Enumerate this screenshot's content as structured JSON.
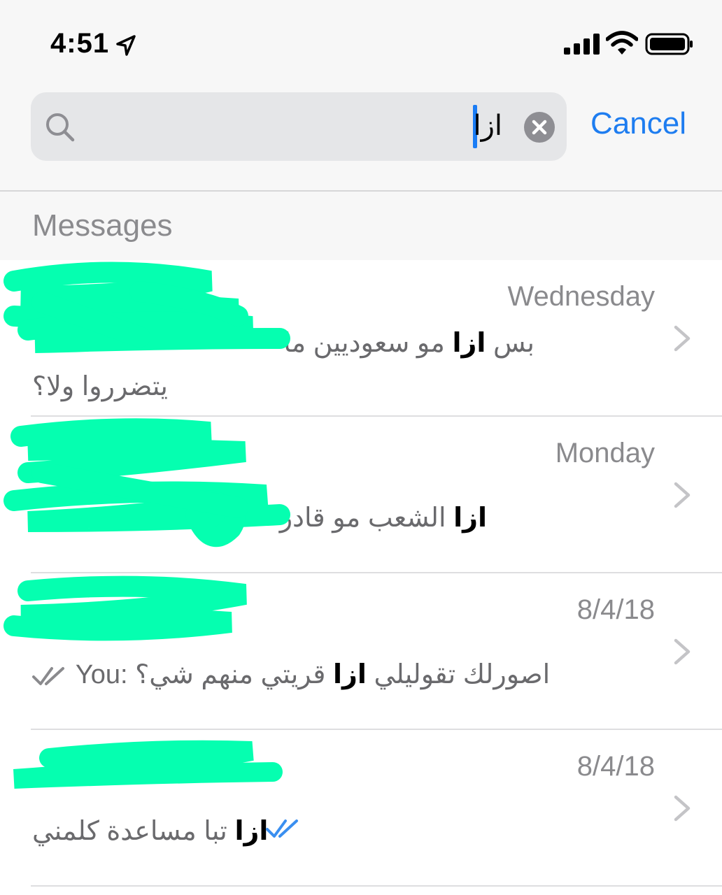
{
  "status_bar": {
    "time": "4:51",
    "icons": [
      "location-arrow-icon",
      "cellular-signal-icon",
      "wifi-icon",
      "battery-icon"
    ]
  },
  "search": {
    "query": "ازا",
    "cancel_label": "Cancel"
  },
  "section_title": "Messages",
  "colors": {
    "accent": "#1e7df0",
    "redaction": "#05ffb0",
    "read_tick_blue": "#3a8ff0",
    "read_tick_gray": "#8a8a8d"
  },
  "results": [
    {
      "date": "Wednesday",
      "pre": "بس ",
      "match": "ازا",
      "post": " مو سعوديين ما",
      "line2": "يتضرروا ولا؟"
    },
    {
      "date": "Monday",
      "pre": "",
      "match": "ازا",
      "post": " الشعب مو قادر"
    },
    {
      "date": "8/4/18",
      "you_label": "You:",
      "pre": "اصورلك تقوليلي ",
      "match": "ازا",
      "post": " قريتي منهم شي؟"
    },
    {
      "date": "8/4/18",
      "pre": "",
      "match": "ازا",
      "post": " تبا مساعدة كلمني"
    }
  ]
}
